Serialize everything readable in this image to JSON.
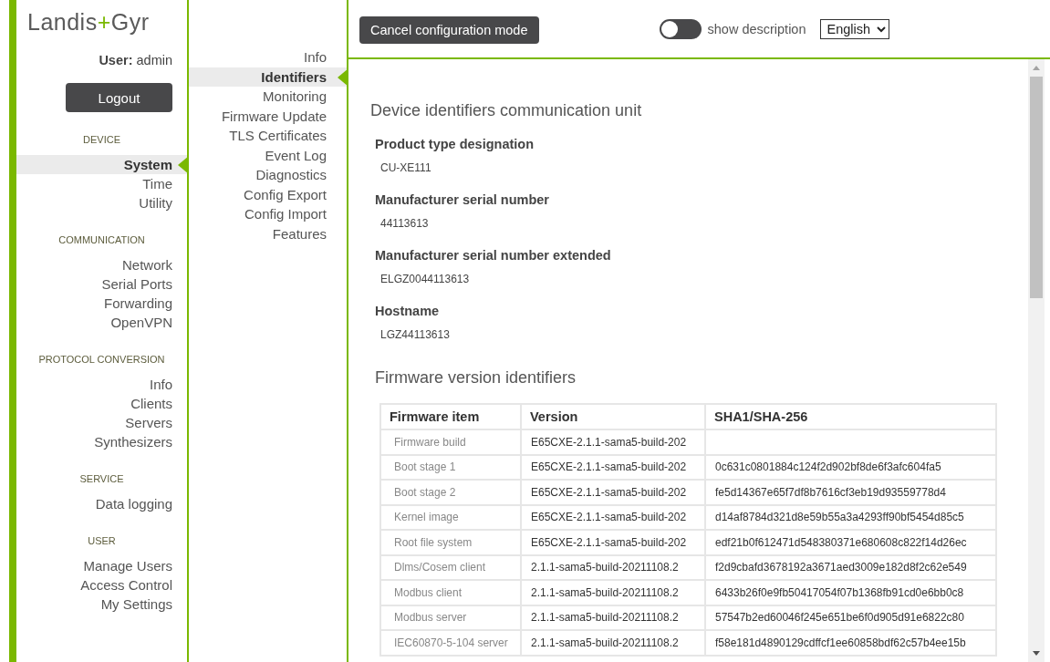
{
  "logo_parts": [
    "Landis",
    "+",
    "Gyr"
  ],
  "user": "**User:** admin",
  "logout_button": "Logout",
  "sidebar": {
    "groups": [
      {
        "heading": "DEVICE",
        "items": [
          {
            "label": "System",
            "selected": true
          },
          {
            "label": "Time",
            "selected": false
          },
          {
            "label": "Utility",
            "selected": false
          }
        ]
      },
      {
        "heading": "COMMUNICATION",
        "items": [
          {
            "label": "Network",
            "selected": false
          },
          {
            "label": "Serial Ports",
            "selected": false
          },
          {
            "label": "Forwarding",
            "selected": false
          },
          {
            "label": "OpenVPN",
            "selected": false
          }
        ]
      },
      {
        "heading": "PROTOCOL CONVERSION",
        "items": [
          {
            "label": "Info",
            "selected": false
          },
          {
            "label": "Clients",
            "selected": false
          },
          {
            "label": "Servers",
            "selected": false
          },
          {
            "label": "Synthesizers",
            "selected": false
          }
        ]
      },
      {
        "heading": "SERVICE",
        "items": [
          {
            "label": "Data logging",
            "selected": false
          }
        ]
      },
      {
        "heading": "USER",
        "items": [
          {
            "label": "Manage Users",
            "selected": false
          },
          {
            "label": "Access Control",
            "selected": false
          },
          {
            "label": "My Settings",
            "selected": false
          }
        ]
      }
    ]
  },
  "submenu": {
    "items": [
      {
        "label": "Info",
        "selected": false
      },
      {
        "label": "Identifiers",
        "selected": true
      },
      {
        "label": "Monitoring",
        "selected": false
      },
      {
        "label": "Firmware Update",
        "selected": false
      },
      {
        "label": "TLS Certificates",
        "selected": false
      },
      {
        "label": "Event Log",
        "selected": false
      },
      {
        "label": "Diagnostics",
        "selected": false
      },
      {
        "label": "Config Export",
        "selected": false
      },
      {
        "label": "Config Import",
        "selected": false
      },
      {
        "label": "Features",
        "selected": false
      }
    ]
  },
  "topbar": {
    "cancel_button": "Cancel configuration mode",
    "show_description": {
      "label": "show description",
      "on": false
    },
    "language": {
      "value": "English"
    }
  },
  "content": {
    "section_title": "Device identifiers communication unit",
    "fields": [
      {
        "label": "Product type designation",
        "value": "CU-XE111"
      },
      {
        "label": "Manufacturer serial number",
        "value": "44113613"
      },
      {
        "label": "Manufacturer serial number extended",
        "value": "ELGZ0044113613"
      },
      {
        "label": "Hostname",
        "value": "LGZ44113613"
      }
    ],
    "firmware_title": "Firmware version identifiers",
    "table": {
      "columns": [
        "Firmware item",
        "Version",
        "SHA1/SHA-256"
      ],
      "rows": [
        [
          "Firmware build",
          "E65CXE-2.1.1-sama5-build-202",
          null
        ],
        [
          "Boot stage 1",
          "E65CXE-2.1.1-sama5-build-202",
          "0c631c0801884c124f2d902bf8de6f3afc604fa5"
        ],
        [
          "Boot stage 2",
          "E65CXE-2.1.1-sama5-build-202",
          "fe5d14367e65f7df8b7616cf3eb19d93559778d4"
        ],
        [
          "Kernel image",
          "E65CXE-2.1.1-sama5-build-202",
          "d14af8784d321d8e59b55a3a4293ff90bf5454d85c5"
        ],
        [
          "Root file system",
          "E65CXE-2.1.1-sama5-build-202",
          "edf21b0f612471d548380371e680608c822f14d26ec"
        ],
        [
          "Dlms/Cosem client",
          "2.1.1-sama5-build-20211108.2",
          "f2d9cbafd3678192a3671aed3009e182d8f2c62e549"
        ],
        [
          "Modbus client",
          "2.1.1-sama5-build-20211108.2",
          "6433b26f0e9fb50417054f07b1368fb91cd0e6bb0c8"
        ],
        [
          "Modbus server",
          "2.1.1-sama5-build-20211108.2",
          "57547b2ed60046f245e651be6f0d905d91e6822c80"
        ],
        [
          "IEC60870-5-104 server",
          "2.1.1-sama5-build-20211108.2",
          "f58e181d4890129cdffcf1ee60858bdf62c57b4ee15b"
        ]
      ]
    }
  }
}
